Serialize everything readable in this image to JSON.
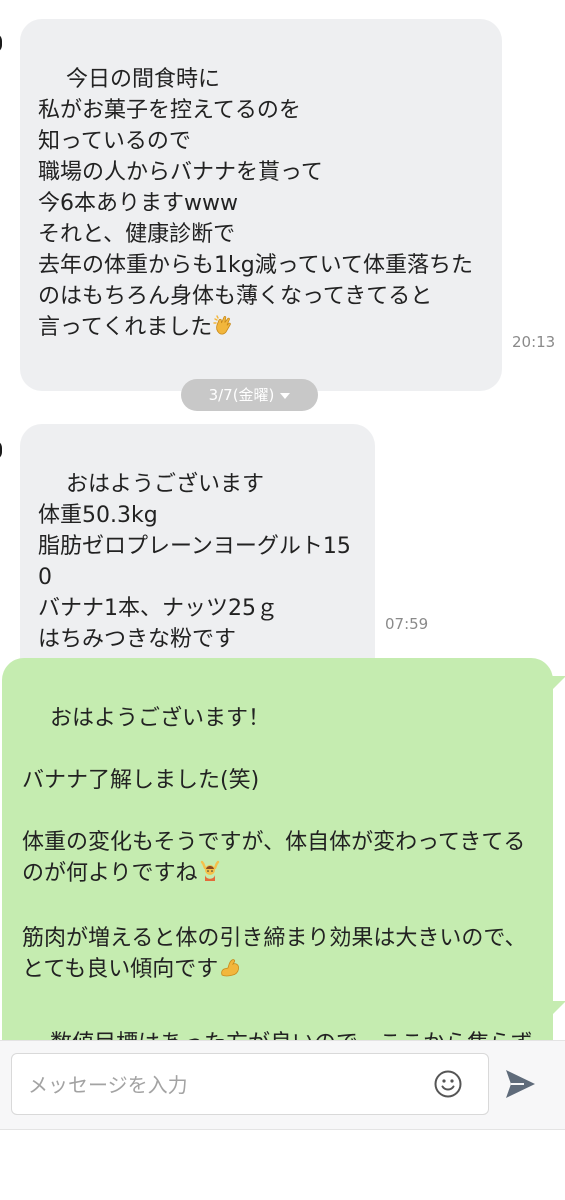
{
  "messages": [
    {
      "from": "other",
      "text": "今日の間食時に\n私がお菓子を控えてるのを\n知っているので\n職場の人からバナナを貰って\n今6本ありますwww\nそれと、健康診断で\n去年の体重からも1kg減っていて体重落ちたのはもちろん身体も薄くなってきてると\n言ってくれました",
      "emoji": "clapping-hands",
      "time": "20:13"
    },
    {
      "from": "other",
      "text": "おはようございます\n体重50.3kg\n脂肪ゼロプレーンヨーグルト150\nバナナ1本、ナッツ25ｇ\nはちみつきな粉です",
      "time": "07:59"
    },
    {
      "from": "me",
      "text": "おはようございます！\n\nバナナ了解しました(笑)\n\n体重の変化もそうですが、体自体が変わってきてるのが何よりですね",
      "text_b": "\n\n筋肉が増えると体の引き締まり効果は大きいので、とても良い傾向です",
      "emoji": "person-raising-hands",
      "emoji_b": "flexed-biceps"
    },
    {
      "from": "me",
      "text": "数値目標はあった方が良いので、ここから焦らずペース乱さずやっていきましょう"
    }
  ],
  "date_separator": "3/7(金曜)",
  "composer": {
    "placeholder": "メッセージを入力",
    "emoji_button": "smiley-icon",
    "send_button": "send-arrow-icon"
  },
  "colors": {
    "incoming_bubble": "#eeeff1",
    "outgoing_bubble": "#c5ecb0",
    "date_pill": "#c8c8c8"
  }
}
